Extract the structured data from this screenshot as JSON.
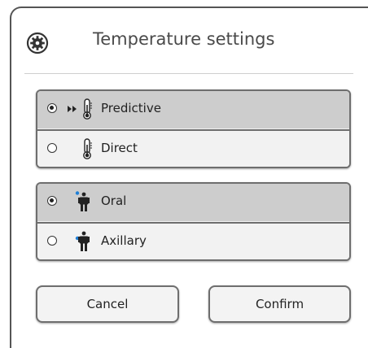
{
  "dialog": {
    "title": "Temperature settings",
    "title_icon": "gear-icon"
  },
  "mode_group": {
    "options": [
      {
        "label": "Predictive",
        "icon": "predictive-thermometer-icon",
        "selected": true
      },
      {
        "label": "Direct",
        "icon": "thermometer-icon",
        "selected": false
      }
    ]
  },
  "site_group": {
    "options": [
      {
        "label": "Oral",
        "icon": "oral-site-icon",
        "selected": true
      },
      {
        "label": "Axillary",
        "icon": "axillary-site-icon",
        "selected": false
      }
    ]
  },
  "buttons": {
    "cancel_label": "Cancel",
    "confirm_label": "Confirm"
  },
  "colors": {
    "selected_bg": "#cdcdcd",
    "unselected_bg": "#f2f2f2",
    "accent_dot": "#1f7fd6",
    "border": "#6e6e6e"
  }
}
